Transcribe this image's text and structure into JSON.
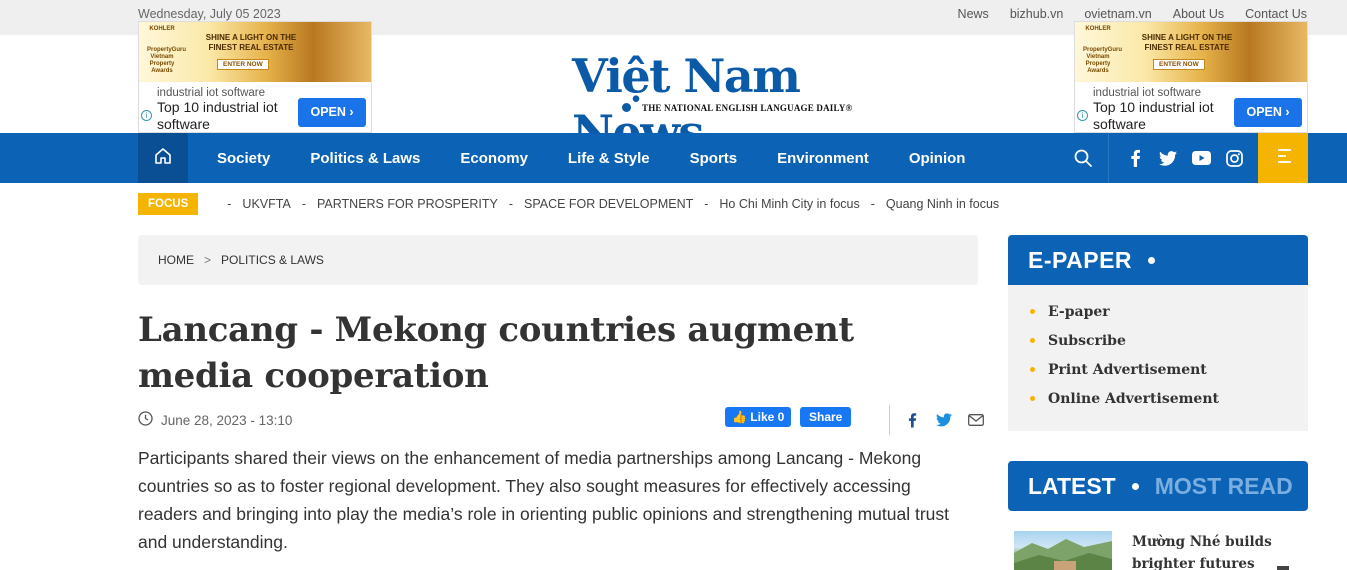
{
  "topbar": {
    "date": "Wednesday, July 05 2023",
    "links": [
      "News",
      "bizhub.vn",
      "ovietnam.vn",
      "About Us",
      "Contact Us"
    ]
  },
  "ads": {
    "banner_brand": "KOHLER",
    "banner_sub": "PropertyGuru Vietnam Property Awards",
    "banner_headline": "SHINE A LIGHT ON THE FINEST REAL ESTATE",
    "banner_cta": "ENTER NOW",
    "small_text": "industrial iot software",
    "big_text": "Top 10 industrial iot software",
    "open_label": "OPEN ›",
    "info_glyph": "i"
  },
  "logo": {
    "name": "Việt Nam News",
    "tagline": "THE NATIONAL ENGLISH LANGUAGE DAILY",
    "registered": "®"
  },
  "nav": {
    "items": [
      "Society",
      "Politics & Laws",
      "Economy",
      "Life & Style",
      "Sports",
      "Environment",
      "Opinion"
    ],
    "icons": [
      "home-icon",
      "search-icon",
      "facebook-icon",
      "twitter-icon",
      "youtube-icon",
      "instagram-icon",
      "menu-icon"
    ]
  },
  "focus": {
    "label": "FOCUS",
    "items": [
      "UKVFTA",
      "PARTNERS FOR PROSPERITY",
      "SPACE FOR DEVELOPMENT",
      "Ho Chi Minh City in focus",
      "Quang Ninh in focus"
    ]
  },
  "breadcrumb": {
    "home": "HOME",
    "separator": ">",
    "current": "POLITICS & LAWS"
  },
  "article": {
    "title": "Lancang - Mekong countries augment media cooperation",
    "datetime": "June 28, 2023 - 13:10",
    "like_label": "Like 0",
    "share_label": "Share",
    "lead": "Participants shared their views on the enhancement of media partnerships among Lancang - Mekong countries so as to foster regional development. They also sought measures for effectively accessing readers and bringing into play the media’s role in orienting public opinions and strengthening mutual trust and understanding."
  },
  "sidebar": {
    "epaper_title": "E-PAPER",
    "epaper_items": [
      "E-paper",
      "Subscribe",
      "Print Advertisement",
      "Online Advertisement"
    ],
    "latest_tab": "LATEST",
    "most_read_tab": "MOST READ",
    "news_item_title": "Mường Nhé builds brighter futures"
  },
  "colors": {
    "brand_blue": "#0c62b4",
    "accent_yellow": "#f4b400",
    "facebook_blue": "#1877f2"
  }
}
